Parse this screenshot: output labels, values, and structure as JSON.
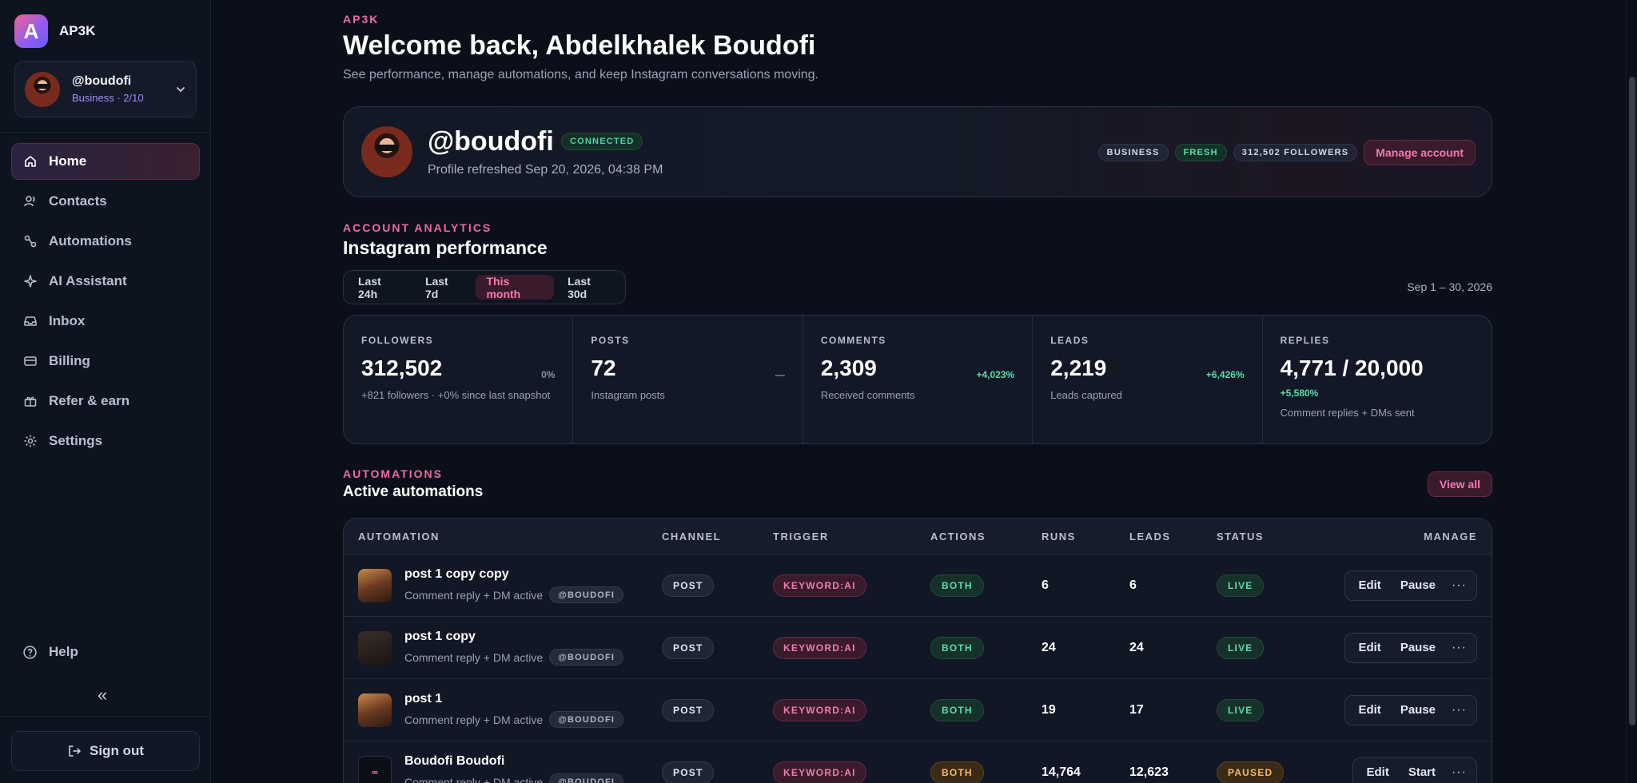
{
  "brand": {
    "letter": "A",
    "name": "AP3K"
  },
  "account": {
    "handle": "@boudofi",
    "plan": "Business · 2/10"
  },
  "nav": [
    {
      "label": "Home",
      "icon": "home-icon",
      "active": true
    },
    {
      "label": "Contacts",
      "icon": "contacts-icon"
    },
    {
      "label": "Automations",
      "icon": "automations-icon"
    },
    {
      "label": "AI Assistant",
      "icon": "sparkle-icon"
    },
    {
      "label": "Inbox",
      "icon": "inbox-icon"
    },
    {
      "label": "Billing",
      "icon": "credit-card-icon"
    },
    {
      "label": "Refer & earn",
      "icon": "gift-icon"
    },
    {
      "label": "Settings",
      "icon": "gear-icon"
    }
  ],
  "help_label": "Help",
  "collapse_glyph": "«",
  "signout_label": "Sign out",
  "hero": {
    "eyebrow": "AP3K",
    "title": "Welcome back, Abdelkhalek Boudofi",
    "subtitle": "See performance, manage automations, and keep Instagram conversations moving."
  },
  "profile": {
    "handle": "@boudofi",
    "status": "CONNECTED",
    "refreshed": "Profile refreshed Sep 20, 2026, 04:38 PM",
    "tags": [
      "BUSINESS",
      "FRESH",
      "312,502 FOLLOWERS"
    ],
    "manage_label": "Manage account"
  },
  "analytics": {
    "eyebrow": "ACCOUNT ANALYTICS",
    "title": "Instagram performance",
    "ranges": [
      "Last 24h",
      "Last 7d",
      "This month",
      "Last 30d"
    ],
    "active_range": "This month",
    "date_range": "Sep 1 – 30, 2026",
    "stats": [
      {
        "label": "FOLLOWERS",
        "value": "312,502",
        "delta": "0%",
        "note": "+821 followers · +0% since last snapshot"
      },
      {
        "label": "POSTS",
        "value": "72",
        "delta": "—",
        "note": "Instagram posts"
      },
      {
        "label": "COMMENTS",
        "value": "2,309",
        "delta": "+4,023%",
        "note": "Received comments"
      },
      {
        "label": "LEADS",
        "value": "2,219",
        "delta": "+6,426%",
        "note": "Leads captured"
      },
      {
        "label": "REPLIES",
        "value": "4,771 / 20,000",
        "delta": "+5,580%",
        "note": "Comment replies + DMs sent"
      }
    ]
  },
  "automations": {
    "eyebrow": "AUTOMATIONS",
    "title": "Active automations",
    "view_all": "View all",
    "columns": [
      "AUTOMATION",
      "CHANNEL",
      "TRIGGER",
      "ACTIONS",
      "RUNS",
      "LEADS",
      "STATUS",
      "MANAGE"
    ],
    "rows": [
      {
        "name": "post 1 copy copy",
        "sub": "Comment reply + DM active",
        "handle": "@BOUDOFI",
        "channel": "POST",
        "trigger": "KEYWORD:AI",
        "actions": "BOTH",
        "runs": "6",
        "leads": "6",
        "status": "LIVE",
        "btn1": "Edit",
        "btn2": "Pause"
      },
      {
        "name": "post 1 copy",
        "sub": "Comment reply + DM active",
        "handle": "@BOUDOFI",
        "channel": "POST",
        "trigger": "KEYWORD:AI",
        "actions": "BOTH",
        "runs": "24",
        "leads": "24",
        "status": "LIVE",
        "btn1": "Edit",
        "btn2": "Pause"
      },
      {
        "name": "post 1",
        "sub": "Comment reply + DM active",
        "handle": "@BOUDOFI",
        "channel": "POST",
        "trigger": "KEYWORD:AI",
        "actions": "BOTH",
        "runs": "19",
        "leads": "17",
        "status": "LIVE",
        "btn1": "Edit",
        "btn2": "Pause"
      },
      {
        "name": "Boudofi Boudofi",
        "sub": "Comment reply + DM active",
        "handle": "@BOUDOFI",
        "channel": "POST",
        "trigger": "KEYWORD:AI",
        "actions": "BOTH",
        "runs": "14,764",
        "leads": "12,623",
        "status": "PAUSED",
        "btn1": "Edit",
        "btn2": "Start",
        "thumb_text": "∞"
      }
    ],
    "more_glyph": "···"
  }
}
